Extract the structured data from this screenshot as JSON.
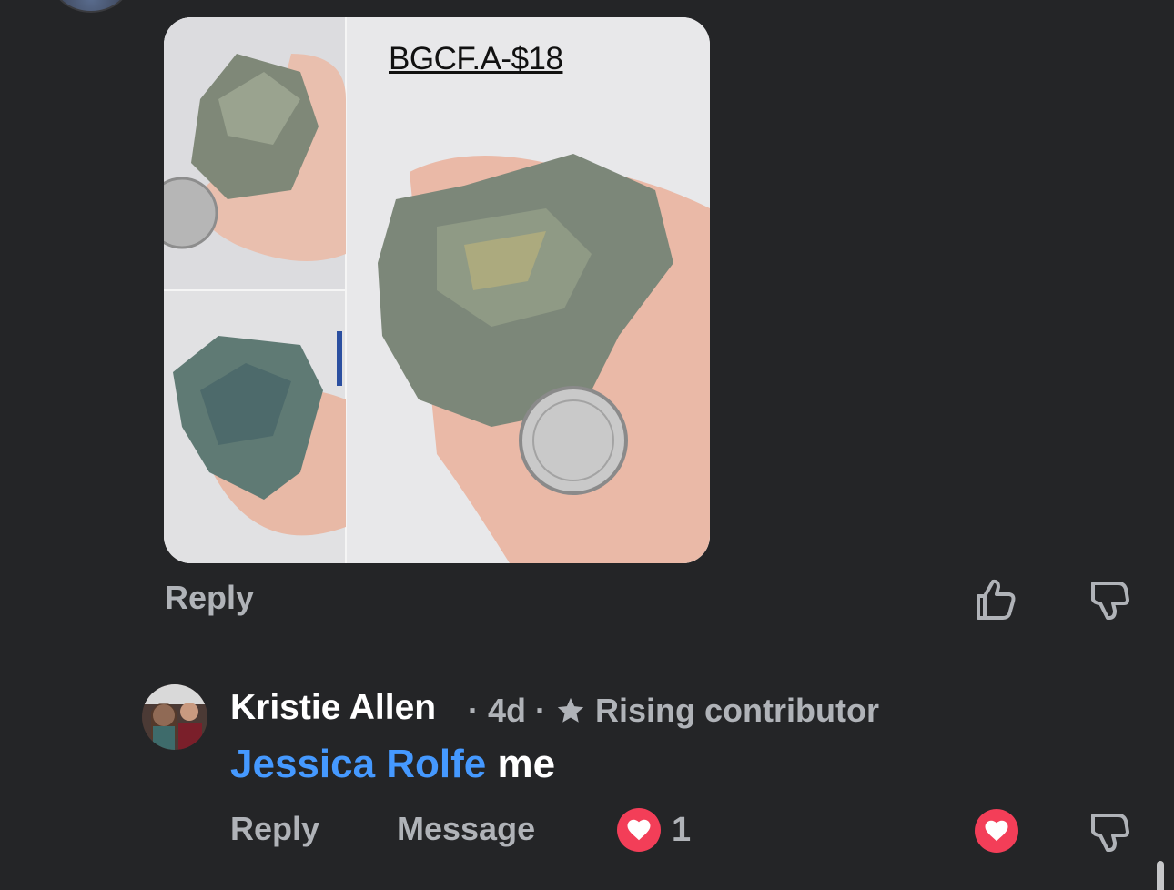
{
  "post": {
    "photo_caption": "BGCF.A-$18",
    "reply_label": "Reply"
  },
  "comment": {
    "author": "Kristie Allen",
    "time": "4d",
    "separator": "·",
    "badge": "Rising contributor",
    "mention": "Jessica Rolfe",
    "text": "me",
    "reply_label": "Reply",
    "message_label": "Message",
    "reaction_count": "1"
  },
  "icons": {
    "like": "thumbs-up-icon",
    "dislike": "thumbs-down-icon",
    "heart": "heart-icon",
    "star": "star-icon"
  },
  "colors": {
    "background": "#242527",
    "mention": "#4599ff",
    "heart": "#f33e58",
    "muted": "#b0b3b8"
  }
}
